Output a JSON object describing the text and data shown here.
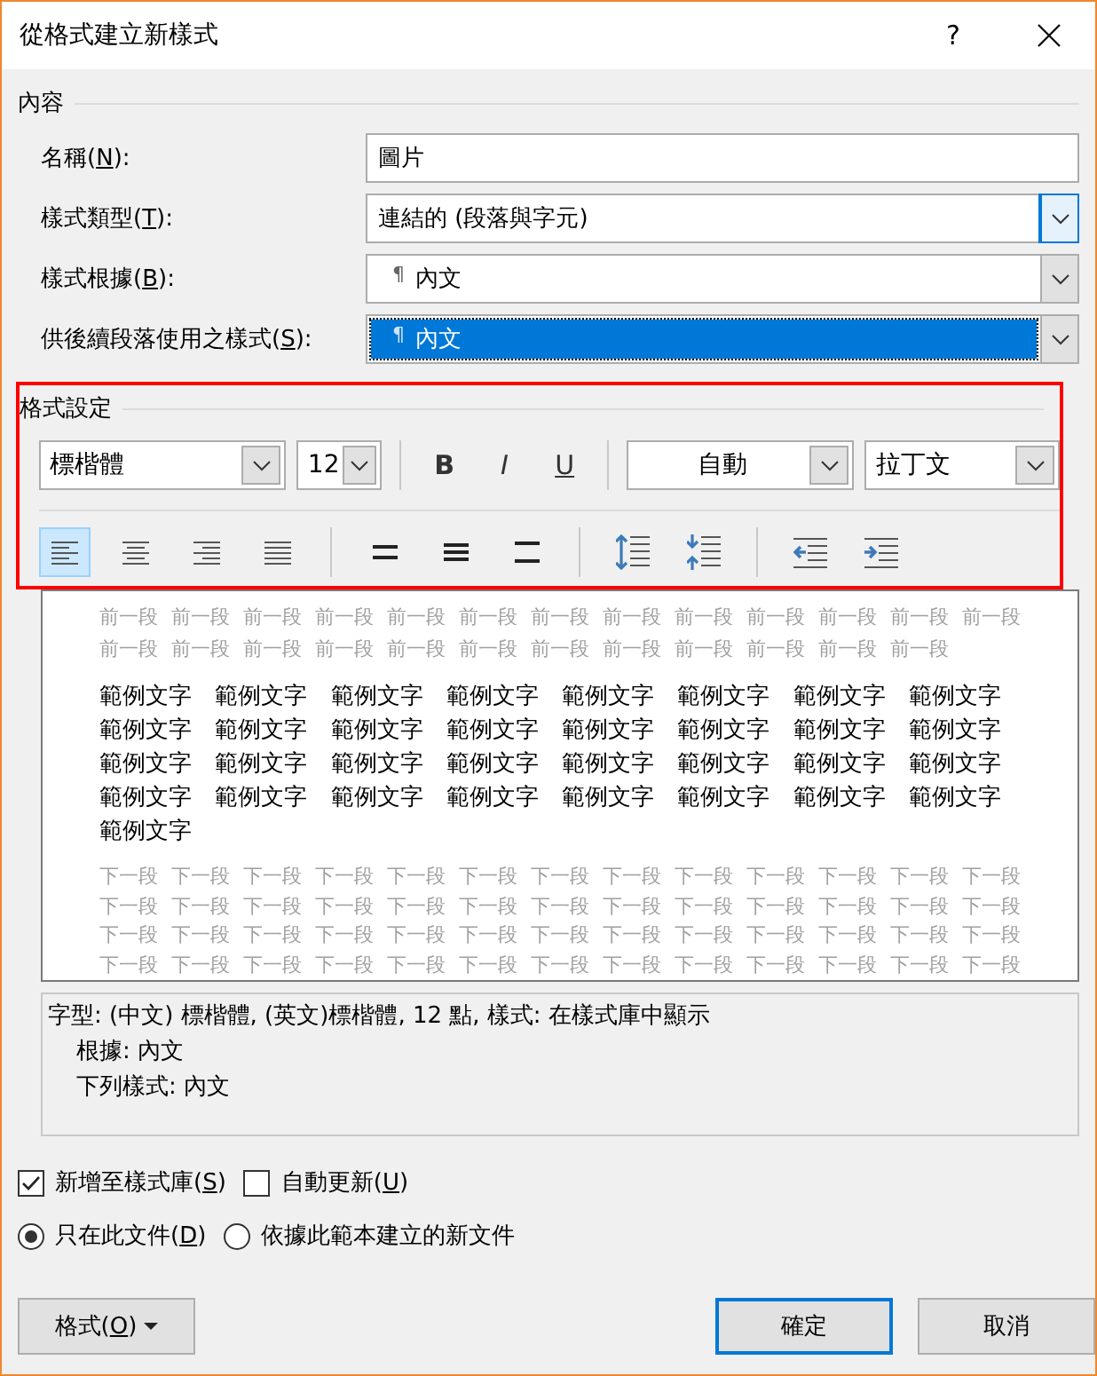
{
  "window": {
    "title": "從格式建立新樣式",
    "help": "?"
  },
  "properties": {
    "heading": "內容",
    "fields": [
      {
        "kind": "text",
        "label": {
          "before": "名稱(",
          "key": "N",
          "after": "):"
        },
        "value": "圖片",
        "highlighted": false
      },
      {
        "kind": "select",
        "label": {
          "before": "樣式類型(",
          "key": "T",
          "after": "):"
        },
        "value": "連結的 (段落與字元)",
        "focused": true,
        "highlighted": false
      },
      {
        "kind": "select",
        "label": {
          "before": "樣式根據(",
          "key": "B",
          "after": "):"
        },
        "mark": "¶",
        "value": "內文",
        "focused": false,
        "highlighted": false
      },
      {
        "kind": "select",
        "label": {
          "before": "供後續段落使用之樣式(",
          "key": "S",
          "after": "):"
        },
        "mark": "¶",
        "value": "內文",
        "focused": false,
        "highlighted": true
      }
    ]
  },
  "formatting": {
    "heading": "格式設定",
    "highlighted": true,
    "font": "標楷體",
    "size": "12",
    "bold": "B",
    "italic": "I",
    "underline": "U",
    "font_color_label": "自動",
    "script": "拉丁文",
    "alignments": [
      {
        "kind": "left",
        "selected": true
      },
      {
        "kind": "center",
        "selected": false
      },
      {
        "kind": "right",
        "selected": false
      },
      {
        "kind": "justify",
        "selected": false
      }
    ]
  },
  "preview": {
    "previous_lines": [
      "前一段 前一段 前一段 前一段 前一段 前一段 前一段 前一段 前一段 前一段 前一段 前一段 前一段",
      "前一段 前一段 前一段 前一段 前一段 前一段 前一段 前一段 前一段 前一段 前一段 前一段"
    ],
    "sample_lines": [
      "範例文字 範例文字 範例文字 範例文字 範例文字 範例文字 範例文字 範例文字",
      "範例文字 範例文字 範例文字 範例文字 範例文字 範例文字 範例文字 範例文字",
      "範例文字 範例文字 範例文字 範例文字 範例文字 範例文字 範例文字 範例文字",
      "範例文字 範例文字 範例文字 範例文字 範例文字 範例文字 範例文字 範例文字",
      "範例文字"
    ],
    "next_lines": [
      "下一段 下一段 下一段 下一段 下一段 下一段 下一段 下一段 下一段 下一段 下一段 下一段 下一段",
      "下一段 下一段 下一段 下一段 下一段 下一段 下一段 下一段 下一段 下一段 下一段 下一段 下一段",
      "下一段 下一段 下一段 下一段 下一段 下一段 下一段 下一段 下一段 下一段 下一段 下一段 下一段",
      "下一段 下一段 下一段 下一段 下一段 下一段 下一段 下一段 下一段 下一段 下一段 下一段 下一段"
    ]
  },
  "description": {
    "summary": "字型: (中文) 標楷體, (英文)標楷體, 12 點, 樣式: 在樣式庫中顯示",
    "details": [
      "根據: 內文",
      "下列樣式: 內文"
    ]
  },
  "checkboxes": [
    {
      "label": {
        "before": "新增至樣式庫(",
        "key": "S",
        "after": ")"
      },
      "checked": true
    },
    {
      "label": {
        "before": "自動更新(",
        "key": "U",
        "after": ")"
      },
      "checked": false
    }
  ],
  "radios": [
    {
      "label": {
        "before": "只在此文件(",
        "key": "D",
        "after": ")"
      },
      "selected": true
    },
    {
      "label": {
        "before": "依據此範本建立的新文件"
      },
      "selected": false
    }
  ],
  "buttons": {
    "format": {
      "label": {
        "before": "格式(",
        "key": "O",
        "after": ")"
      }
    },
    "ok": {
      "label": "確定",
      "default": true
    },
    "cancel": {
      "label": "取消",
      "default": false
    }
  }
}
